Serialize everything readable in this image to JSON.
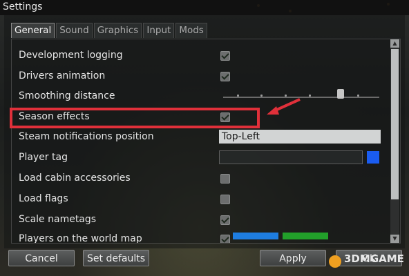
{
  "window": {
    "title": "Settings"
  },
  "tabs": [
    {
      "label": "General",
      "active": true
    },
    {
      "label": "Sound",
      "active": false
    },
    {
      "label": "Graphics",
      "active": false
    },
    {
      "label": "Input",
      "active": false
    },
    {
      "label": "Mods",
      "active": false
    }
  ],
  "settings": {
    "development_logging": {
      "label": "Development logging",
      "checked": true
    },
    "drivers_animation": {
      "label": "Drivers animation",
      "checked": true
    },
    "smoothing_distance": {
      "label": "Smoothing distance",
      "level": 0.75
    },
    "season_effects": {
      "label": "Season effects",
      "checked": true
    },
    "steam_notifications_position": {
      "label": "Steam notifications position",
      "value": "Top-Left"
    },
    "player_tag": {
      "label": "Player tag",
      "value": "",
      "color": "#1a5cf0"
    },
    "load_cabin_accessories": {
      "label": "Load cabin accessories",
      "checked": false
    },
    "load_flags": {
      "label": "Load flags",
      "checked": false
    },
    "scale_nametags": {
      "label": "Scale nametags",
      "checked": true
    },
    "players_on_world_map": {
      "label": "Players on the world map",
      "checked": true,
      "colors": [
        "#1e7de0",
        "#22a02a"
      ]
    }
  },
  "buttons": {
    "cancel": "Cancel",
    "set_defaults": "Set defaults",
    "apply": "Apply",
    "ok": "OK"
  },
  "watermark": "3DMGAME",
  "annotation": {
    "color": "#e0303a"
  }
}
